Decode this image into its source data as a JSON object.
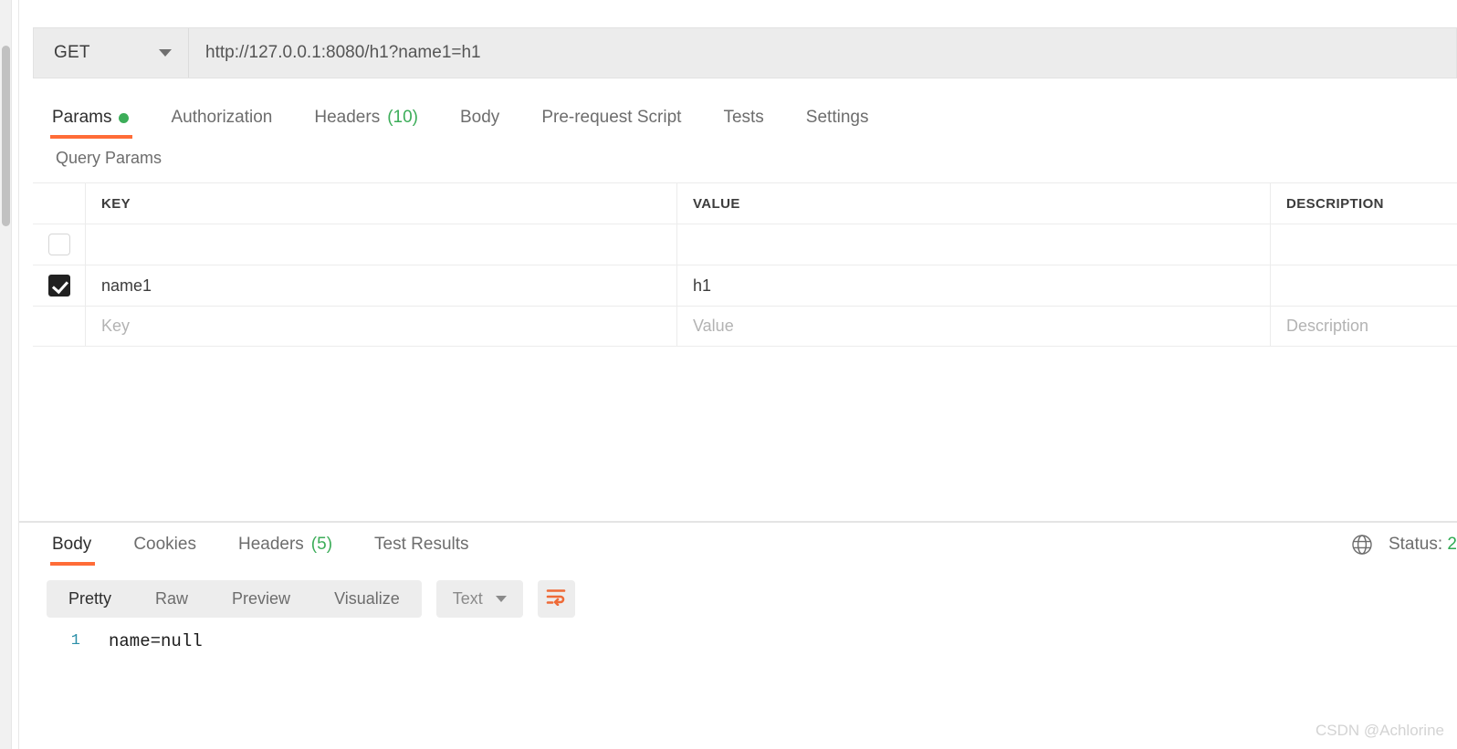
{
  "request": {
    "method": "GET",
    "url": "http://127.0.0.1:8080/h1?name1=h1",
    "tabs": [
      {
        "label": "Params",
        "dot": true,
        "active": true
      },
      {
        "label": "Authorization",
        "active": false
      },
      {
        "label": "Headers",
        "count": "(10)",
        "active": false
      },
      {
        "label": "Body",
        "active": false
      },
      {
        "label": "Pre-request Script",
        "active": false
      },
      {
        "label": "Tests",
        "active": false
      },
      {
        "label": "Settings",
        "active": false
      }
    ],
    "params_section_title": "Query Params",
    "table": {
      "columns": [
        "KEY",
        "VALUE",
        "DESCRIPTION"
      ],
      "rows": [
        {
          "checked": false,
          "key": "",
          "value": "",
          "description": ""
        },
        {
          "checked": true,
          "key": "name1",
          "value": "h1",
          "description": ""
        }
      ],
      "placeholder_row": {
        "key": "Key",
        "value": "Value",
        "description": "Description"
      }
    }
  },
  "response": {
    "tabs": [
      {
        "label": "Body",
        "active": true
      },
      {
        "label": "Cookies",
        "active": false
      },
      {
        "label": "Headers",
        "count": "(5)",
        "active": false
      },
      {
        "label": "Test Results",
        "active": false
      }
    ],
    "status_label": "Status:",
    "status_code": "2",
    "view_modes": [
      {
        "label": "Pretty",
        "active": true
      },
      {
        "label": "Raw",
        "active": false
      },
      {
        "label": "Preview",
        "active": false
      },
      {
        "label": "Visualize",
        "active": false
      }
    ],
    "format": "Text",
    "body_lines": [
      {
        "number": "1",
        "text": "name=null"
      }
    ]
  },
  "watermark": "CSDN @Achlorine",
  "colors": {
    "accent": "#ff6c37",
    "success": "#3cad59",
    "status": "#2faa52",
    "line_number": "#2b8fa8",
    "toolbar_bg": "#ededed",
    "urlbar_bg": "#ececec"
  }
}
